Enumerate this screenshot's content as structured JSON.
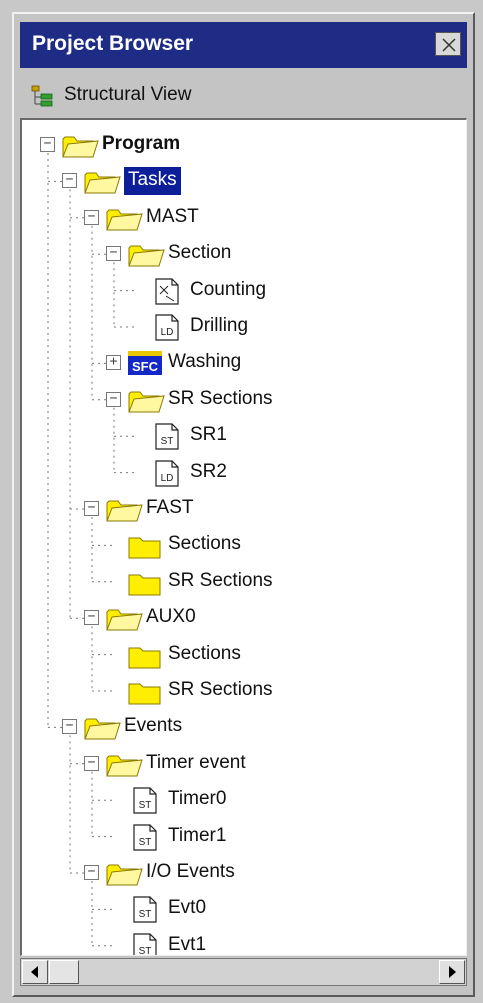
{
  "window": {
    "title": "Project Browser",
    "view_label": "Structural View"
  },
  "tree": [
    {
      "label": "Program",
      "depth": 0,
      "icon": "folder-open-icon",
      "expander": "minus",
      "bold": true
    },
    {
      "label": "Tasks",
      "depth": 1,
      "icon": "folder-open-icon",
      "expander": "minus",
      "selected": true
    },
    {
      "label": "MAST",
      "depth": 2,
      "icon": "folder-open-icon",
      "expander": "minus"
    },
    {
      "label": "Section",
      "depth": 3,
      "icon": "folder-open-icon",
      "expander": "minus"
    },
    {
      "label": "Counting",
      "depth": 4,
      "icon": "fbd-doc-icon"
    },
    {
      "label": "Drilling",
      "depth": 4,
      "icon": "ld-doc-icon",
      "doc_text": "LD"
    },
    {
      "label": "Washing",
      "depth": 3,
      "icon": "sfc-icon",
      "expander": "plus",
      "sfc_text": "SFC"
    },
    {
      "label": "SR Sections",
      "depth": 3,
      "icon": "folder-open-icon",
      "expander": "minus"
    },
    {
      "label": "SR1",
      "depth": 4,
      "icon": "st-doc-icon",
      "doc_text": "ST"
    },
    {
      "label": "SR2",
      "depth": 4,
      "icon": "ld-doc-icon",
      "doc_text": "LD"
    },
    {
      "label": "FAST",
      "depth": 2,
      "icon": "folder-open-icon",
      "expander": "minus"
    },
    {
      "label": "Sections",
      "depth": 3,
      "icon": "folder-closed-icon"
    },
    {
      "label": "SR Sections",
      "depth": 3,
      "icon": "folder-closed-icon"
    },
    {
      "label": "AUX0",
      "depth": 2,
      "icon": "folder-open-icon",
      "expander": "minus"
    },
    {
      "label": "Sections",
      "depth": 3,
      "icon": "folder-closed-icon"
    },
    {
      "label": "SR Sections",
      "depth": 3,
      "icon": "folder-closed-icon"
    },
    {
      "label": "Events",
      "depth": 1,
      "icon": "folder-open-icon",
      "expander": "minus"
    },
    {
      "label": "Timer event",
      "depth": 2,
      "icon": "folder-open-icon",
      "expander": "minus"
    },
    {
      "label": "Timer0",
      "depth": 3,
      "icon": "st-doc-icon",
      "doc_text": "ST"
    },
    {
      "label": "Timer1",
      "depth": 3,
      "icon": "st-doc-icon",
      "doc_text": "ST"
    },
    {
      "label": "I/O Events",
      "depth": 2,
      "icon": "folder-open-icon",
      "expander": "minus"
    },
    {
      "label": "Evt0",
      "depth": 3,
      "icon": "st-doc-icon",
      "doc_text": "ST"
    },
    {
      "label": "Evt1",
      "depth": 3,
      "icon": "st-doc-icon",
      "doc_text": "ST"
    }
  ],
  "colors": {
    "title_bar": "#1e2c86",
    "selection": "#0c1e98",
    "folder": "#ffee00",
    "sfc_bg": "#1428c8"
  }
}
